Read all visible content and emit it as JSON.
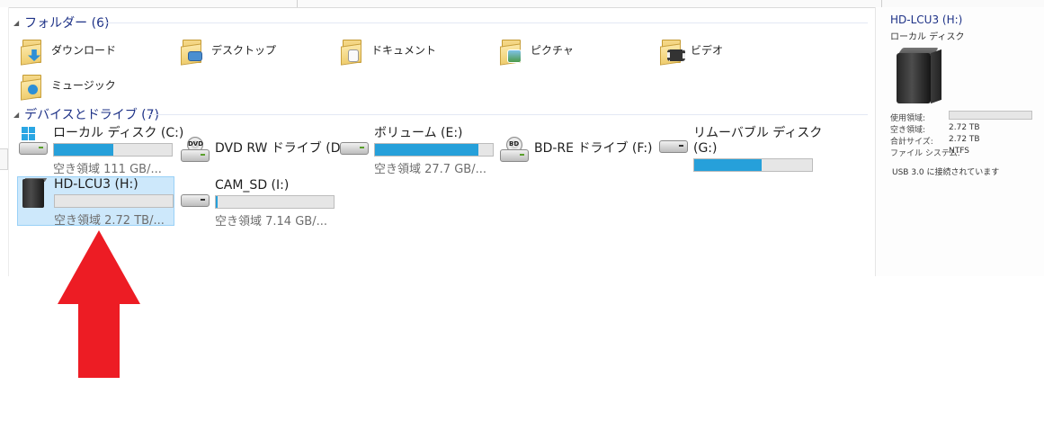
{
  "colors": {
    "accent": "#26a0da",
    "header_text": "#1e3287",
    "selection_bg": "#cde8fb",
    "arrow": "#ed1c24"
  },
  "folders_group": {
    "title": "フォルダー (6)",
    "items": [
      {
        "label": "ダウンロード",
        "icon": "downloads-folder-icon"
      },
      {
        "label": "デスクトップ",
        "icon": "desktop-folder-icon"
      },
      {
        "label": "ドキュメント",
        "icon": "documents-folder-icon"
      },
      {
        "label": "ピクチャ",
        "icon": "pictures-folder-icon"
      },
      {
        "label": "ビデオ",
        "icon": "videos-folder-icon"
      },
      {
        "label": "ミュージック",
        "icon": "music-folder-icon"
      }
    ]
  },
  "devices_group": {
    "title": "デバイスとドライブ (7)",
    "drives": [
      {
        "name": "ローカル ディスク (C:)",
        "free": "空き領域 111 GB/...",
        "used_fraction": 0.5,
        "icon": "windows-drive-icon"
      },
      {
        "name": "DVD RW ドライブ (D:)",
        "free": "",
        "icon": "dvd-drive-icon"
      },
      {
        "name": "ボリューム (E:)",
        "free": "空き領域 27.7 GB/...",
        "used_fraction": 0.88,
        "icon": "hard-drive-icon"
      },
      {
        "name": "BD-RE ドライブ (F:)",
        "free": "",
        "icon": "bd-drive-icon"
      },
      {
        "name": "リムーバブル ディスク",
        "name2": "(G:)",
        "free": "",
        "used_fraction": 0.57,
        "icon": "removable-drive-icon"
      },
      {
        "name": "HD-LCU3 (H:)",
        "free": "空き領域 2.72 TB/...",
        "used_fraction": 0.0,
        "icon": "external-hdd-icon",
        "selected": true
      },
      {
        "name": "CAM_SD (I:)",
        "free": "空き領域 7.14 GB/...",
        "used_fraction": 0.01,
        "icon": "sd-card-drive-icon"
      }
    ]
  },
  "details_pane": {
    "title": "HD-LCU3 (H:)",
    "subtitle": "ローカル ディスク",
    "rows": [
      {
        "label": "使用領域:",
        "value": ""
      },
      {
        "label": "空き領域:",
        "value": "2.72 TB"
      },
      {
        "label": "合計サイズ:",
        "value": "2.72 TB"
      },
      {
        "label": "ファイル システム:",
        "value": "NTFS"
      }
    ],
    "used_fraction": 0.0,
    "status": "USB 3.0 に接続されています"
  }
}
